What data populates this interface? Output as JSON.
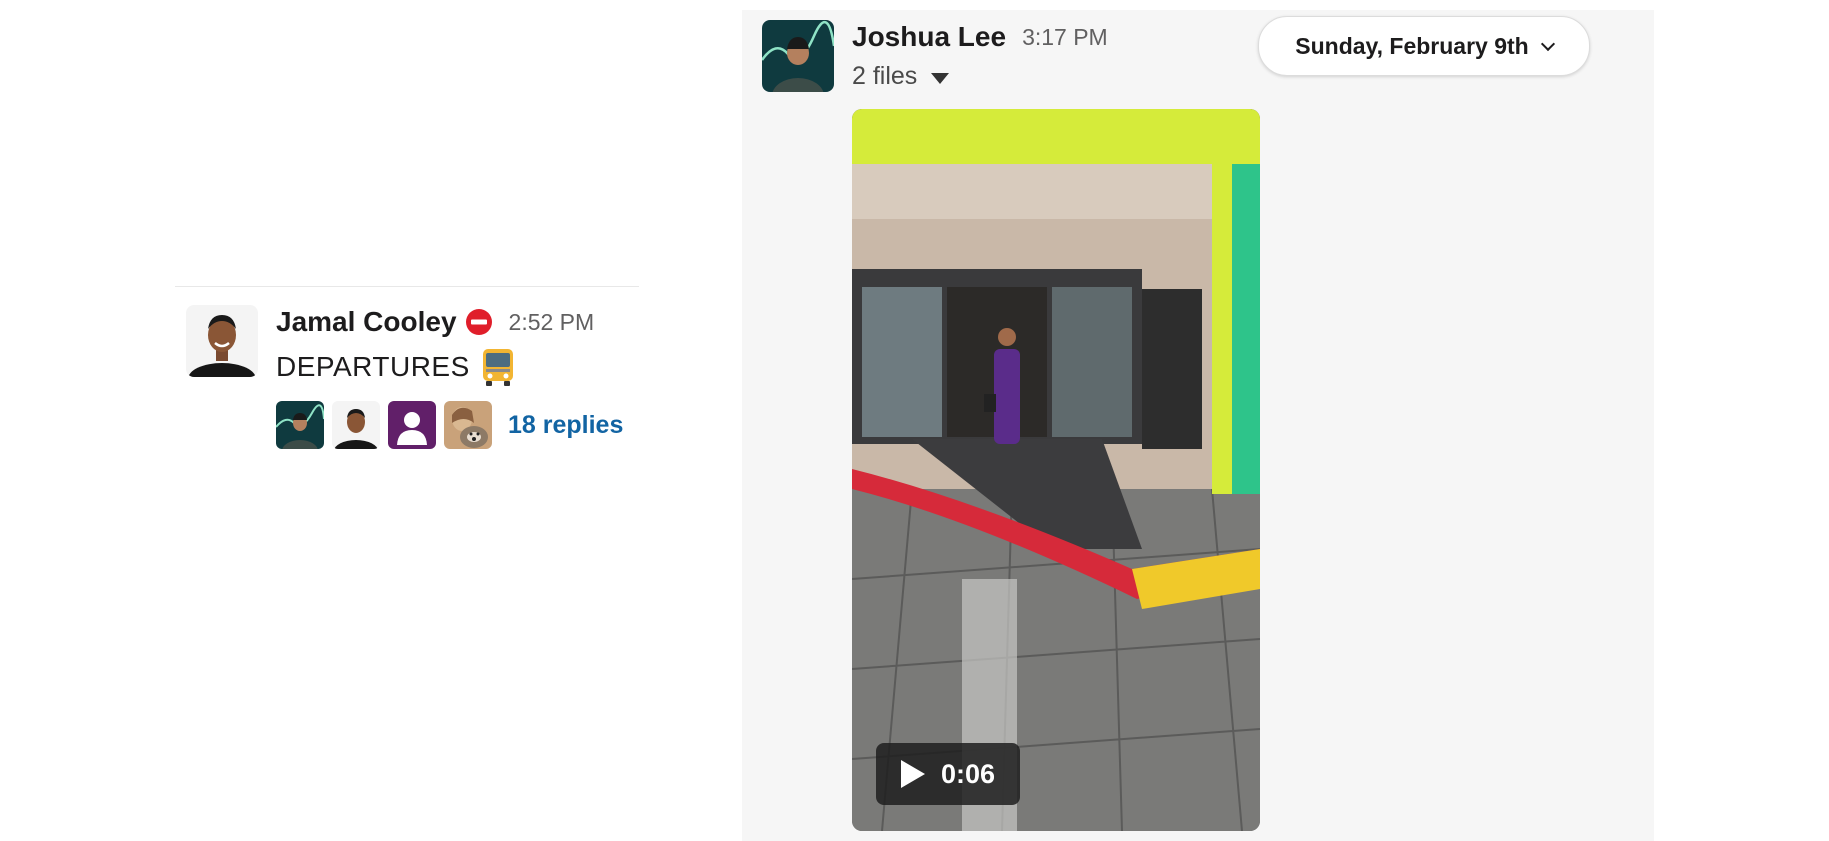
{
  "left_message": {
    "author": "Jamal Cooley",
    "status_icon": "no-entry-icon",
    "timestamp": "2:52 PM",
    "text": "DEPARTURES",
    "emoji": "bus-icon",
    "reply_avatars": [
      "avatar-joshua-lee",
      "avatar-jamal-cooley",
      "avatar-default-user",
      "avatar-dog-photo"
    ],
    "replies": "18 replies"
  },
  "right_message": {
    "author": "Joshua Lee",
    "timestamp": "3:17 PM",
    "files": "2 files",
    "date_divider": "Sunday, February 9th",
    "video": {
      "duration": "0:06"
    }
  },
  "colors": {
    "link": "#1264a3",
    "panel_bg": "#f6f6f6",
    "default_avatar": "#611f69"
  }
}
